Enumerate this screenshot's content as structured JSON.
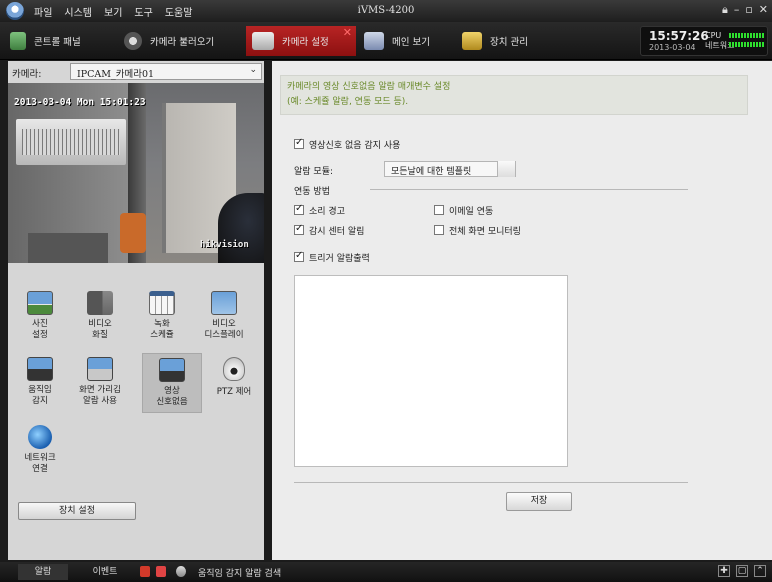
{
  "title_bar": {
    "menu": [
      "파일",
      "시스템",
      "보기",
      "도구",
      "도움말"
    ],
    "app_title": "iVMS-4200",
    "window_controls": [
      "lock-icon",
      "minimize-icon",
      "restore-icon",
      "close-icon"
    ]
  },
  "toolbar": {
    "tabs": [
      {
        "label": "콘트롤 패널",
        "icon": "control-panel-icon"
      },
      {
        "label": "카메라 불러오기",
        "icon": "camera-icon"
      },
      {
        "label": "카메라 설정",
        "icon": "camera-settings-icon",
        "active": true
      },
      {
        "label": "메인 보기",
        "icon": "main-view-icon"
      },
      {
        "label": "장치 관리",
        "icon": "device-management-icon"
      }
    ],
    "clock": {
      "time": "15:57:26",
      "date": "2013-03-04"
    },
    "meters": {
      "cpu_label": "CPU",
      "network_label": "네트워크"
    }
  },
  "left_panel": {
    "camera_label": "카메라:",
    "camera_value": "IPCAM_카메라01",
    "video_osd": "2013-03-04 Mon 15:01:23",
    "watermark": "hikvision",
    "function_icons": [
      {
        "label": "사진\n설정",
        "icon": "image-settings-icon"
      },
      {
        "label": "비디오\n화질",
        "icon": "video-quality-icon"
      },
      {
        "label": "녹화\n스케쥴",
        "icon": "calendar-icon"
      },
      {
        "label": "비디오\n디스플레이",
        "icon": "video-display-icon"
      },
      {
        "label": "움직임\n감지",
        "icon": "motion-detection-icon"
      },
      {
        "label": "화면 가리김\n알람 사용",
        "icon": "tamper-alarm-icon"
      },
      {
        "label": "영상\n신호없음",
        "icon": "video-loss-icon",
        "selected": true
      },
      {
        "label": "PTZ 제어",
        "icon": "ptz-camera-icon"
      },
      {
        "label": "네트워크\n연결",
        "icon": "network-globe-icon"
      }
    ],
    "device_settings_button": "장치 설정"
  },
  "right_panel": {
    "notice_line1": "카메라의 영상 신호없음 알람 매개변수 설정",
    "notice_line2": "(예: 스케쥴 알람, 연동 모드 등).",
    "enable_label": "영상신호 없음 감지 사용",
    "enable_checked": true,
    "template_label": "알람 모듈:",
    "template_value": "모든날에 대한 템플릿",
    "linkage_heading": "연동 방법",
    "linkage_options": [
      {
        "label": "소리 경고",
        "checked": true
      },
      {
        "label": "이메일 연동",
        "checked": false
      },
      {
        "label": "감시 센터 알림",
        "checked": true
      },
      {
        "label": "전체 화면 모니터링",
        "checked": false
      }
    ],
    "trigger_label": "트리거 알람출력",
    "trigger_checked": true,
    "save_button": "저장"
  },
  "status_bar": {
    "tabs": [
      "알람",
      "이벤트"
    ],
    "message": "움직임 감지 알람 검색"
  }
}
